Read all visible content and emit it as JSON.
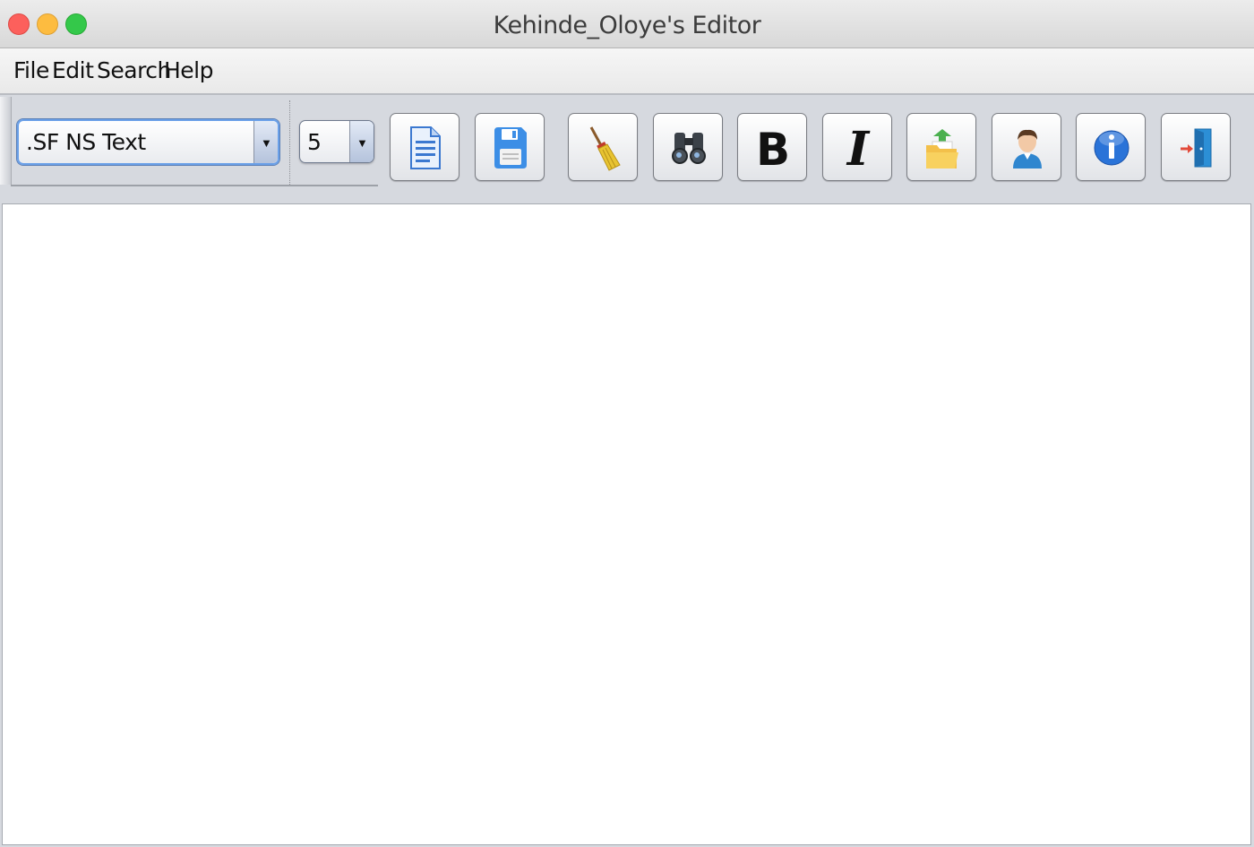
{
  "window": {
    "title": "Kehinde_Oloye's Editor"
  },
  "menubar": {
    "items": [
      {
        "label": "File"
      },
      {
        "label": "Edit"
      },
      {
        "label": "Search"
      },
      {
        "label": "Help"
      }
    ]
  },
  "toolbar": {
    "font_select": {
      "value": ".SF NS Text"
    },
    "size_select": {
      "value": "5"
    },
    "buttons": [
      {
        "icon": "new-document-icon"
      },
      {
        "icon": "save-floppy-icon"
      },
      {
        "icon": "broom-clear-icon"
      },
      {
        "icon": "binoculars-search-icon"
      },
      {
        "icon": "bold-icon"
      },
      {
        "icon": "italic-icon"
      },
      {
        "icon": "open-folder-icon"
      },
      {
        "icon": "user-icon"
      },
      {
        "icon": "info-icon"
      },
      {
        "icon": "exit-door-icon"
      }
    ]
  },
  "editor": {
    "content": ""
  }
}
